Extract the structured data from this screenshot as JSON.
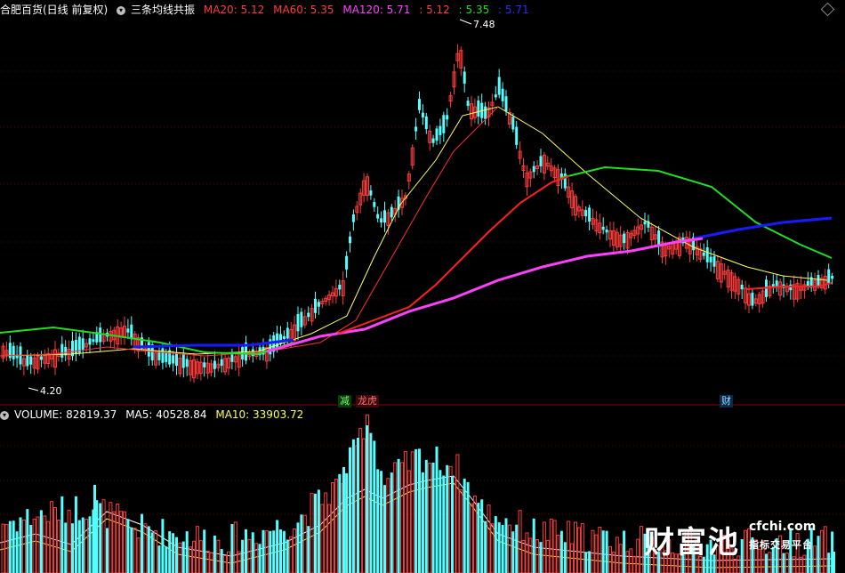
{
  "header": {
    "stock_title": "合肥百货(日线 前复权)",
    "indicator_name": "三条均线共振",
    "ma20_label": "MA20: 5.12",
    "ma60_label": "MA60: 5.35",
    "ma120_label": "MA120: 5.71",
    "val1": ": 5.12",
    "val2": ": 5.35",
    "val3": ": 5.71"
  },
  "volume_header": {
    "volume_label": "VOLUME: 82819.37",
    "ma5_label": "MA5: 40528.84",
    "ma10_label": "MA10: 33903.72"
  },
  "markers": {
    "high": "7.48",
    "low": "4.20",
    "event1": "减",
    "event2": "龙虎",
    "event3": "财"
  },
  "logo": {
    "chinese": "财富池",
    "domain": "cfchi.com",
    "subtitle": "指标交易平台"
  },
  "colors": {
    "ma20": "#ff3030",
    "ma60": "#ff3030",
    "ma120": "#ff40ff",
    "green_line": "#22dd22",
    "blue_line": "#1a1aff",
    "up": "#ff3c3c",
    "down": "#54ffff",
    "yellow": "#ffff50"
  },
  "chart_data": {
    "type": "candlestick",
    "price_high": 7.48,
    "price_low": 4.2,
    "ma_values": {
      "MA20": 5.12,
      "MA60": 5.35,
      "MA120": 5.71
    },
    "volume": 82819.37,
    "volume_ma5": 40528.84,
    "volume_ma10": 33903.72
  }
}
